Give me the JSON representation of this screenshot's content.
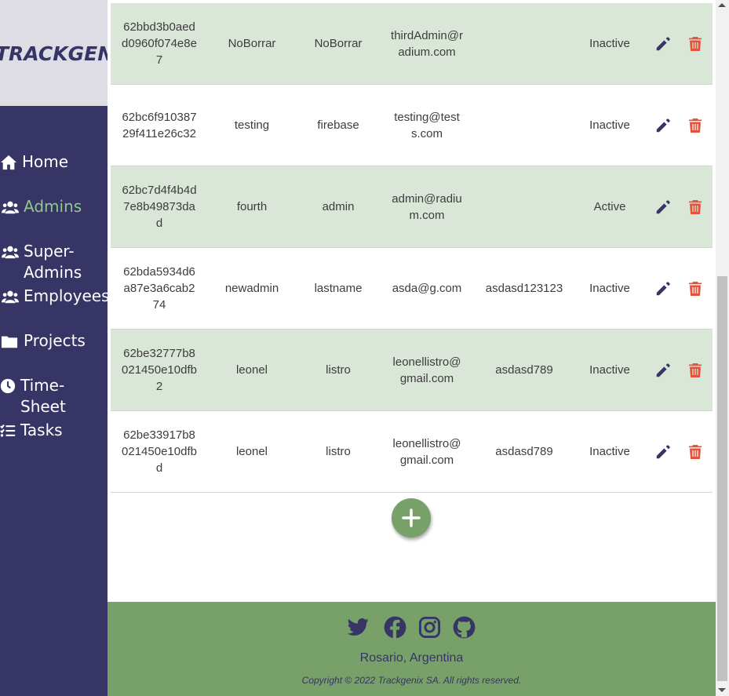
{
  "brand": {
    "logo_text": "TRACKGENIX"
  },
  "sidebar": {
    "items": [
      {
        "label": "Home",
        "icon": "home-icon",
        "active": false
      },
      {
        "label": "Admins",
        "icon": "users-icon",
        "active": true
      },
      {
        "label": "Super-Admins",
        "icon": "users-icon",
        "active": false
      },
      {
        "label": "Employees",
        "icon": "users-icon",
        "active": false
      },
      {
        "label": "Projects",
        "icon": "folder-icon",
        "active": false
      },
      {
        "label": "Time-Sheet",
        "icon": "clock-icon",
        "active": false
      },
      {
        "label": "Tasks",
        "icon": "tasks-icon",
        "active": false
      }
    ]
  },
  "table": {
    "rows": [
      {
        "id": "62bbd3b0aedd0960f074e8e7",
        "name": "NoBorrar",
        "last_name": "NoBorrar",
        "email": "thirdAdmin@radium.com",
        "password": "",
        "status": "Inactive"
      },
      {
        "id": "62bc6f91038729f411e26c32",
        "name": "testing",
        "last_name": "firebase",
        "email": "testing@tests.com",
        "password": "",
        "status": "Inactive"
      },
      {
        "id": "62bc7d4f4b4d7e8b49873dad",
        "name": "fourth",
        "last_name": "admin",
        "email": "admin@radium.com",
        "password": "",
        "status": "Active"
      },
      {
        "id": "62bda5934d6a87e3a6cab274",
        "name": "newadmin",
        "last_name": "lastname",
        "email": "asda@g.com",
        "password": "asdasd123123",
        "status": "Inactive"
      },
      {
        "id": "62be32777b8021450e10dfb2",
        "name": "leonel",
        "last_name": "listro",
        "email": "leonellistro@gmail.com",
        "password": "asdasd789",
        "status": "Inactive"
      },
      {
        "id": "62be33917b8021450e10dfbd",
        "name": "leonel",
        "last_name": "listro",
        "email": "leonellistro@gmail.com",
        "password": "asdasd789",
        "status": "Inactive"
      }
    ]
  },
  "footer": {
    "social": [
      "twitter-icon",
      "facebook-icon",
      "instagram-icon",
      "github-icon"
    ],
    "location": "Rosario, Argentina",
    "copyright": "Copyright © 2022 Trackgenix SA. All rights reserved."
  },
  "colors": {
    "sidebar": "#373566",
    "active": "#8fc98a",
    "row_alt": "#dae6d8",
    "accent_green": "#78a069",
    "delete": "#e5533d"
  }
}
